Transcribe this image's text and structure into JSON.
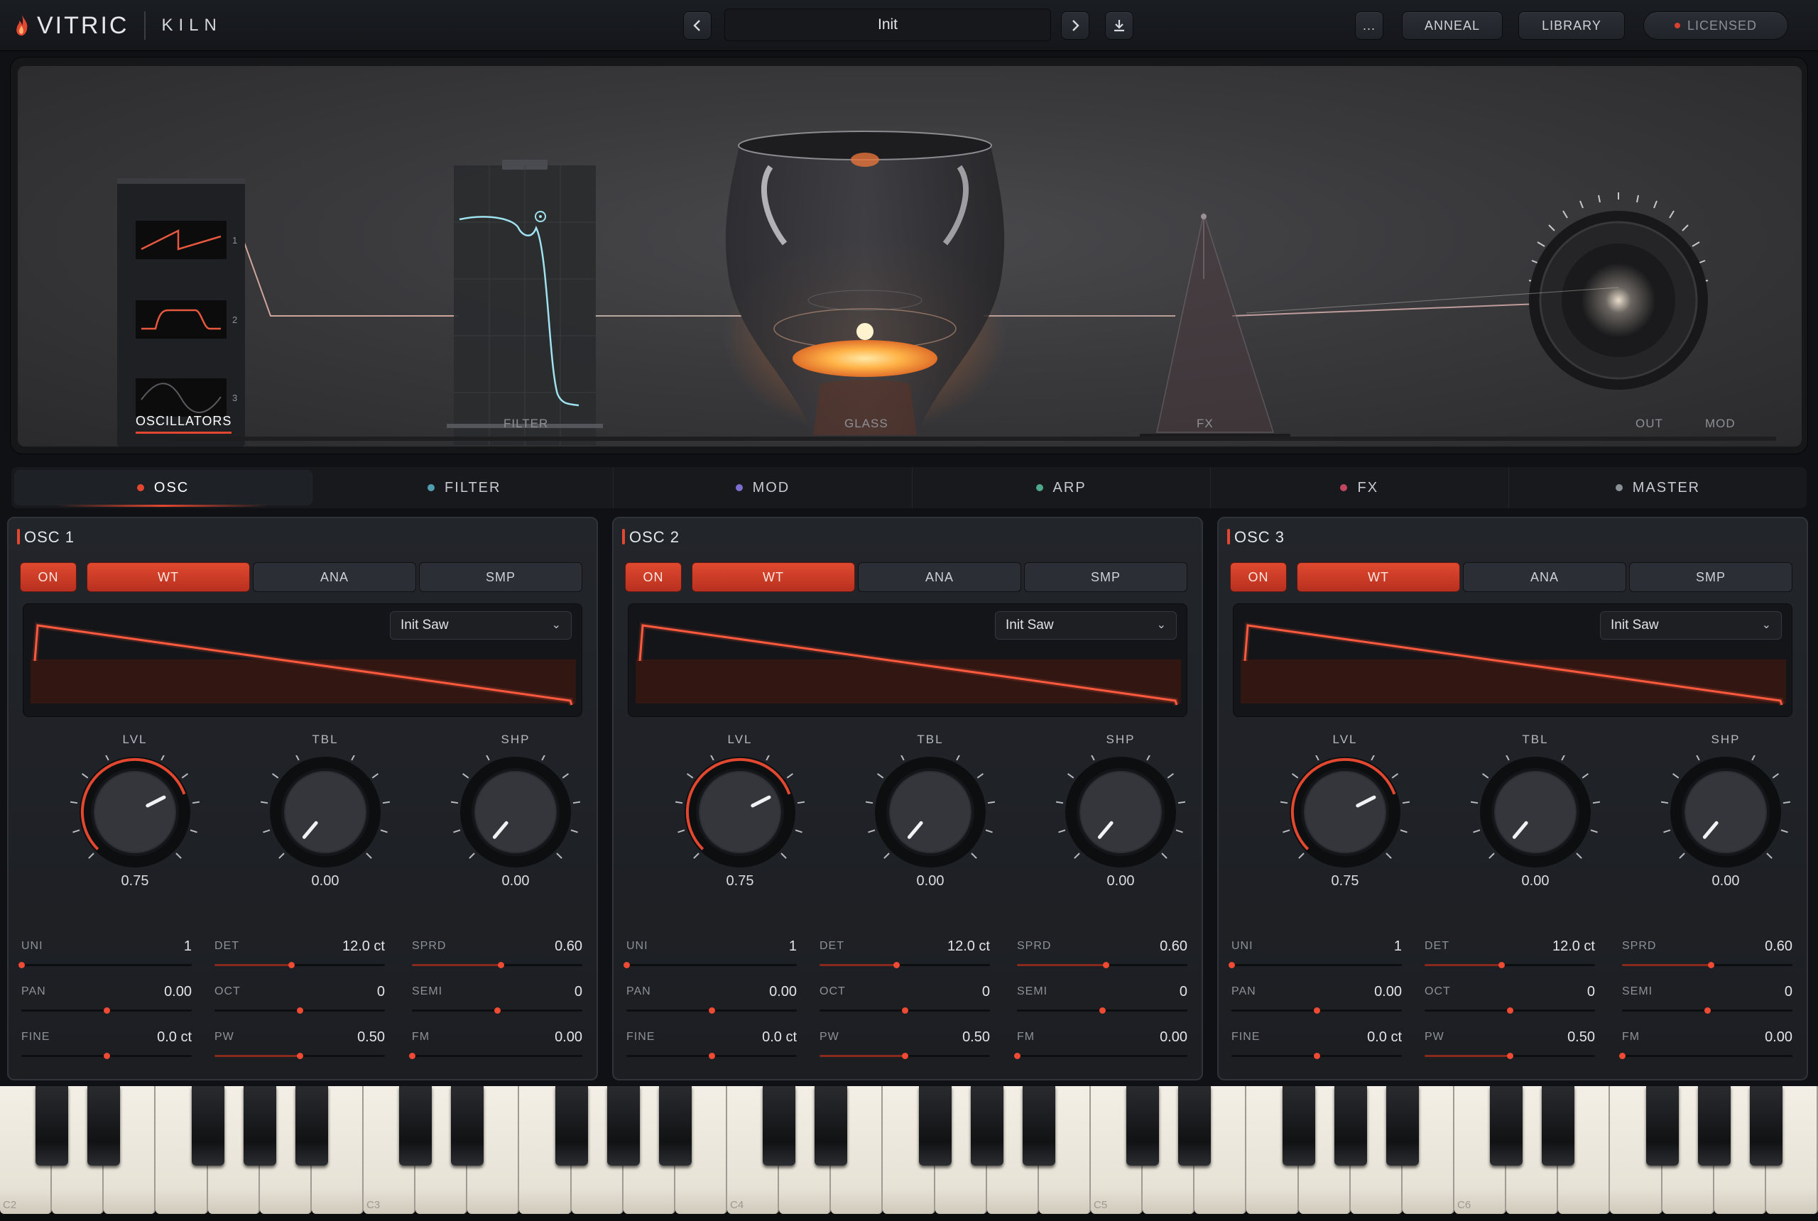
{
  "header": {
    "brand": "VITRIC",
    "product": "KILN",
    "preset_name": "Init",
    "more_label": "...",
    "anneal_label": "ANNEAL",
    "library_label": "LIBRARY",
    "licensed_label": "LICENSED"
  },
  "stage": {
    "oscillators_label": "OSCILLATORS",
    "osc_numbers": [
      "1",
      "2",
      "3"
    ],
    "filter_label": "FILTER",
    "glass_label": "GLASS",
    "fx_label": "FX",
    "out_label": "OUT",
    "mod_label": "MOD"
  },
  "tabs": [
    {
      "label": "OSC",
      "color": "#e2472f"
    },
    {
      "label": "FILTER",
      "color": "#4f9fb0"
    },
    {
      "label": "MOD",
      "color": "#7a6fd0"
    },
    {
      "label": "ARP",
      "color": "#4fa88a"
    },
    {
      "label": "FX",
      "color": "#c0475f"
    },
    {
      "label": "MASTER",
      "color": "#8a8f96"
    }
  ],
  "osc_panels": [
    {
      "title": "OSC 1",
      "on_label": "ON",
      "modes": [
        "WT",
        "ANA",
        "SMP"
      ],
      "wavetable": "Init Saw",
      "knobs": [
        {
          "label": "LVL",
          "value": "0.75"
        },
        {
          "label": "TBL",
          "value": "0.00"
        },
        {
          "label": "SHP",
          "value": "0.00"
        }
      ],
      "params": [
        {
          "name": "UNI",
          "value": "1"
        },
        {
          "name": "DET",
          "value": "12.0 ct"
        },
        {
          "name": "SPRD",
          "value": "0.60"
        },
        {
          "name": "PAN",
          "value": "0.00"
        },
        {
          "name": "OCT",
          "value": "0"
        },
        {
          "name": "SEMI",
          "value": "0"
        },
        {
          "name": "FINE",
          "value": "0.0 ct"
        },
        {
          "name": "PW",
          "value": "0.50"
        },
        {
          "name": "FM",
          "value": "0.00"
        }
      ]
    },
    {
      "title": "OSC 2",
      "on_label": "ON",
      "modes": [
        "WT",
        "ANA",
        "SMP"
      ],
      "wavetable": "Init Saw",
      "knobs": [
        {
          "label": "LVL",
          "value": "0.75"
        },
        {
          "label": "TBL",
          "value": "0.00"
        },
        {
          "label": "SHP",
          "value": "0.00"
        }
      ],
      "params": [
        {
          "name": "UNI",
          "value": "1"
        },
        {
          "name": "DET",
          "value": "12.0 ct"
        },
        {
          "name": "SPRD",
          "value": "0.60"
        },
        {
          "name": "PAN",
          "value": "0.00"
        },
        {
          "name": "OCT",
          "value": "0"
        },
        {
          "name": "SEMI",
          "value": "0"
        },
        {
          "name": "FINE",
          "value": "0.0 ct"
        },
        {
          "name": "PW",
          "value": "0.50"
        },
        {
          "name": "FM",
          "value": "0.00"
        }
      ]
    },
    {
      "title": "OSC 3",
      "on_label": "ON",
      "modes": [
        "WT",
        "ANA",
        "SMP"
      ],
      "wavetable": "Init Saw",
      "knobs": [
        {
          "label": "LVL",
          "value": "0.75"
        },
        {
          "label": "TBL",
          "value": "0.00"
        },
        {
          "label": "SHP",
          "value": "0.00"
        }
      ],
      "params": [
        {
          "name": "UNI",
          "value": "1"
        },
        {
          "name": "DET",
          "value": "12.0 ct"
        },
        {
          "name": "SPRD",
          "value": "0.60"
        },
        {
          "name": "PAN",
          "value": "0.00"
        },
        {
          "name": "OCT",
          "value": "0"
        },
        {
          "name": "SEMI",
          "value": "0"
        },
        {
          "name": "FINE",
          "value": "0.0 ct"
        },
        {
          "name": "PW",
          "value": "0.50"
        },
        {
          "name": "FM",
          "value": "0.00"
        }
      ]
    }
  ],
  "keyboard": {
    "octave_labels": [
      "C2",
      "C3",
      "C4",
      "C5",
      "C6"
    ]
  }
}
